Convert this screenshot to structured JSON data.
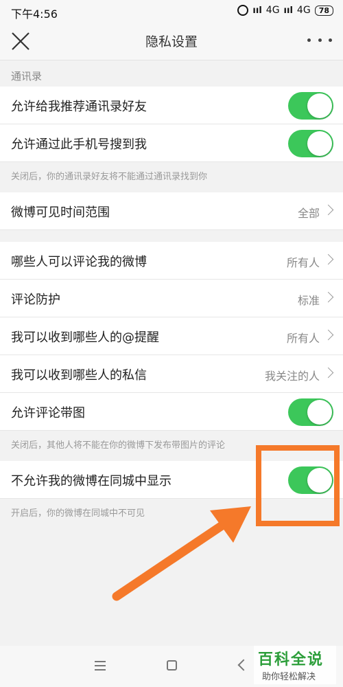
{
  "status_bar": {
    "time": "下午4:56",
    "net1": "4G",
    "net2": "4G",
    "battery": "78"
  },
  "header": {
    "title": "隐私设置"
  },
  "contacts_section": {
    "label": "通讯录"
  },
  "rows": [
    {
      "label": "允许给我推荐通讯录好友",
      "toggle_on": true
    },
    {
      "label": "允许通过此手机号搜到我",
      "toggle_on": true
    }
  ],
  "contacts_hint": "关闭后，你的通讯录好友将不能通过通讯录找到你",
  "weibo_visible": {
    "label": "微博可见时间范围",
    "value": "全部"
  },
  "comment_rows": [
    {
      "label": "哪些人可以评论我的微博",
      "value": "所有人"
    },
    {
      "label": "评论防护",
      "value": "标准"
    },
    {
      "label": "我可以收到哪些人的@提醒",
      "value": "所有人"
    },
    {
      "label": "我可以收到哪些人的私信",
      "value": "我关注的人"
    }
  ],
  "image_comment": {
    "label": "允许评论带图",
    "toggle_on": true
  },
  "image_comment_hint": "关闭后，其他人将不能在你的微博下发布带图片的评论",
  "same_city": {
    "label": "不允许我的微博在同城中显示",
    "toggle_on": true
  },
  "same_city_hint": "开启后，你的微博在同城中不可见",
  "watermark": {
    "title": "百科全说",
    "subtitle": "助你轻松解决"
  },
  "colors": {
    "toggle_on": "#3cc75a",
    "highlight": "#f5792a",
    "watermark": "#2c9e3a"
  }
}
